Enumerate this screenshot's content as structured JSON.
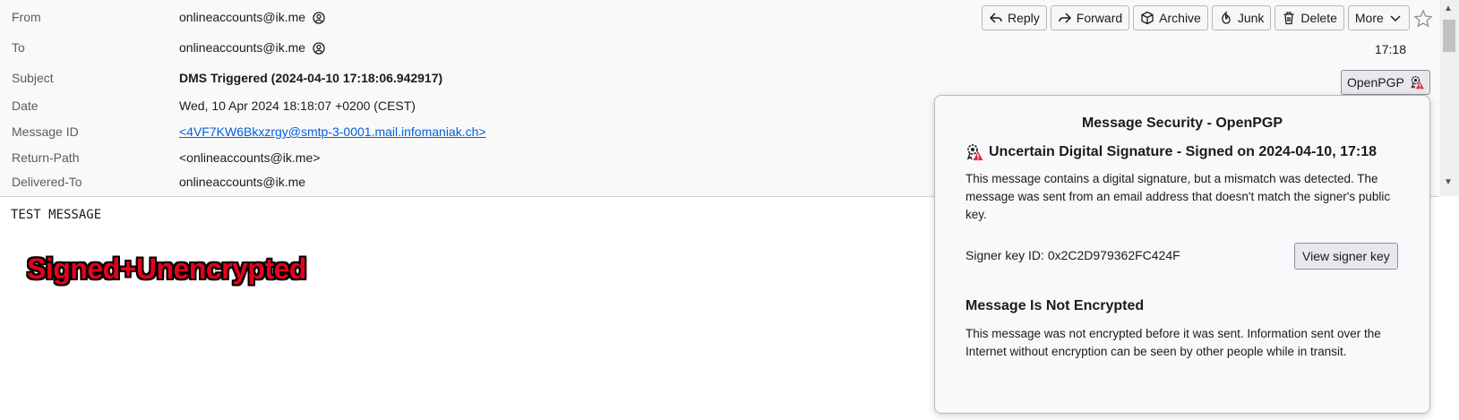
{
  "headers": [
    {
      "label": "From",
      "value": "onlineaccounts@ik.me"
    },
    {
      "label": "To",
      "value": "onlineaccounts@ik.me"
    },
    {
      "label": "Subject",
      "value": "DMS Triggered (2024-04-10 17:18:06.942917)"
    },
    {
      "label": "Date",
      "value": "Wed, 10 Apr 2024 18:18:07 +0200 (CEST)"
    },
    {
      "label": "Message ID",
      "value": "<4VF7KW6Bkxzrgy@smtp-3-0001.mail.infomaniak.ch>"
    },
    {
      "label": "Return-Path",
      "value": "<onlineaccounts@ik.me>"
    },
    {
      "label": "Delivered-To",
      "value": "onlineaccounts@ik.me"
    }
  ],
  "toolbar": {
    "reply": "Reply",
    "forward": "Forward",
    "archive": "Archive",
    "junk": "Junk",
    "delete": "Delete",
    "more": "More"
  },
  "time": "17:18",
  "openpgp_button": "OpenPGP",
  "body": {
    "text": "TEST MESSAGE",
    "stamp": "Signed+Unencrypted"
  },
  "popup": {
    "title": "Message Security - OpenPGP",
    "signature_title": "Uncertain Digital Signature - Signed on 2024-04-10, 17:18",
    "signature_desc": "This message contains a digital signature, but a mismatch was detected. The message was sent from an email address that doesn't match the signer's public key.",
    "signer_key": "Signer key ID: 0x2C2D979362FC424F",
    "view_key_button": "View signer key",
    "encryption_title": "Message Is Not Encrypted",
    "encryption_desc": "This message was not encrypted before it was sent. Information sent over the Internet without encryption can be seen by other people while in transit."
  },
  "colors": {
    "link": "#0060df",
    "warning": "#e22850",
    "stamp": "#e8001c"
  },
  "icons": {
    "contact": "contact-icon",
    "warning_seal": "signature-warning-icon"
  }
}
